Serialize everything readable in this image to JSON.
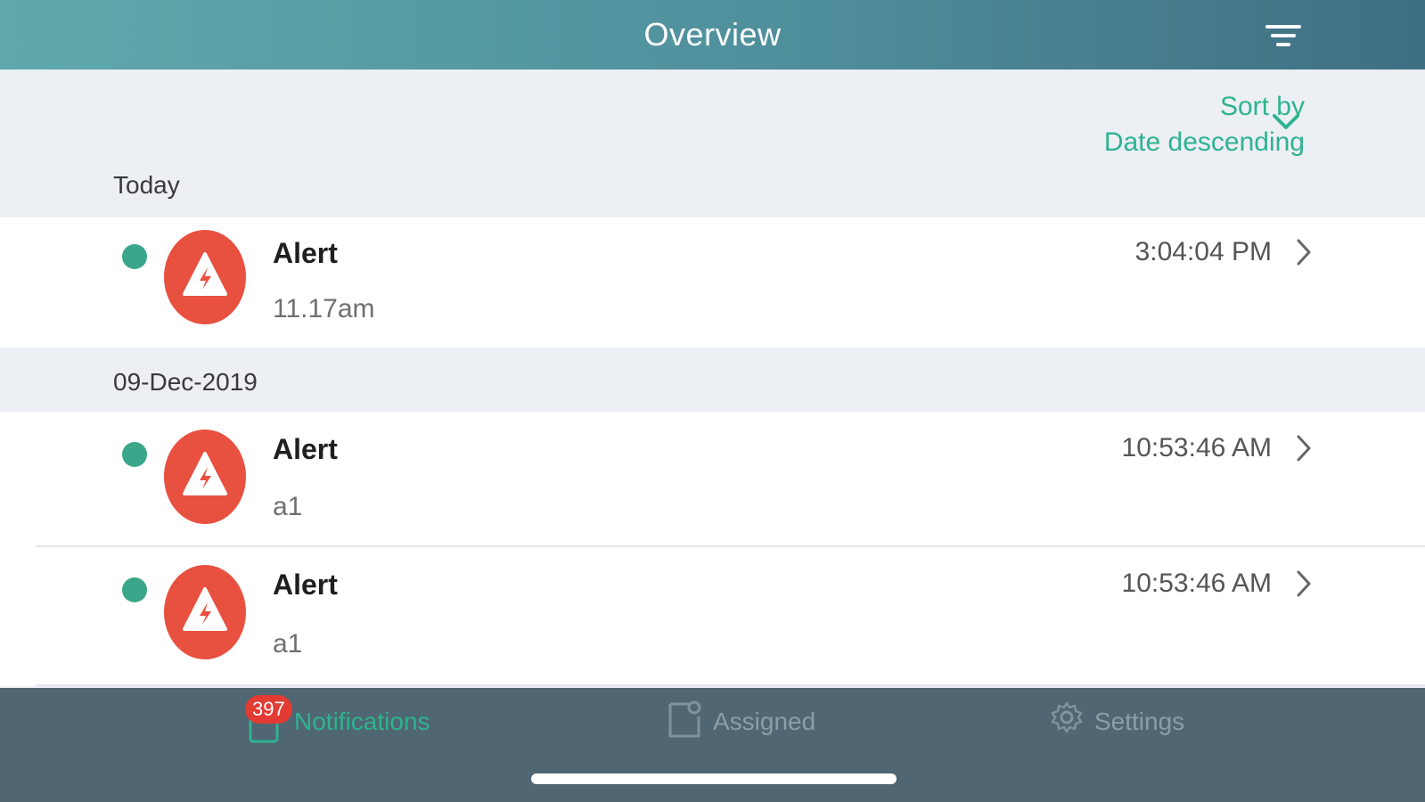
{
  "header": {
    "title": "Overview",
    "filter_icon": "filter-icon"
  },
  "sort": {
    "label": "Sort by",
    "value": "Date descending",
    "chevron_icon": "chevron-down-icon"
  },
  "sections": [
    {
      "label": "Today",
      "items": [
        {
          "title": "Alert",
          "subtitle": "11.17am",
          "time": "3:04:04 PM",
          "unread": true,
          "icon": "alert-warning-icon"
        }
      ]
    },
    {
      "label": "09-Dec-2019",
      "items": [
        {
          "title": "Alert",
          "subtitle": "a1",
          "time": "10:53:46 AM",
          "unread": true,
          "icon": "alert-warning-icon"
        },
        {
          "title": "Alert",
          "subtitle": "a1",
          "time": "10:53:46 AM",
          "unread": true,
          "icon": "alert-warning-icon"
        }
      ]
    }
  ],
  "tabbar": {
    "tabs": [
      {
        "label": "Notifications",
        "icon": "notifications-icon",
        "badge": "397",
        "active": true
      },
      {
        "label": "Assigned",
        "icon": "assigned-icon",
        "active": false
      },
      {
        "label": "Settings",
        "icon": "gear-icon",
        "active": false
      }
    ]
  },
  "colors": {
    "accent": "#2eb38f",
    "alert_red": "#e8503f",
    "unread_dot": "#3aa68a",
    "tabbar_bg": "#506672",
    "badge_red": "#e23b33"
  }
}
